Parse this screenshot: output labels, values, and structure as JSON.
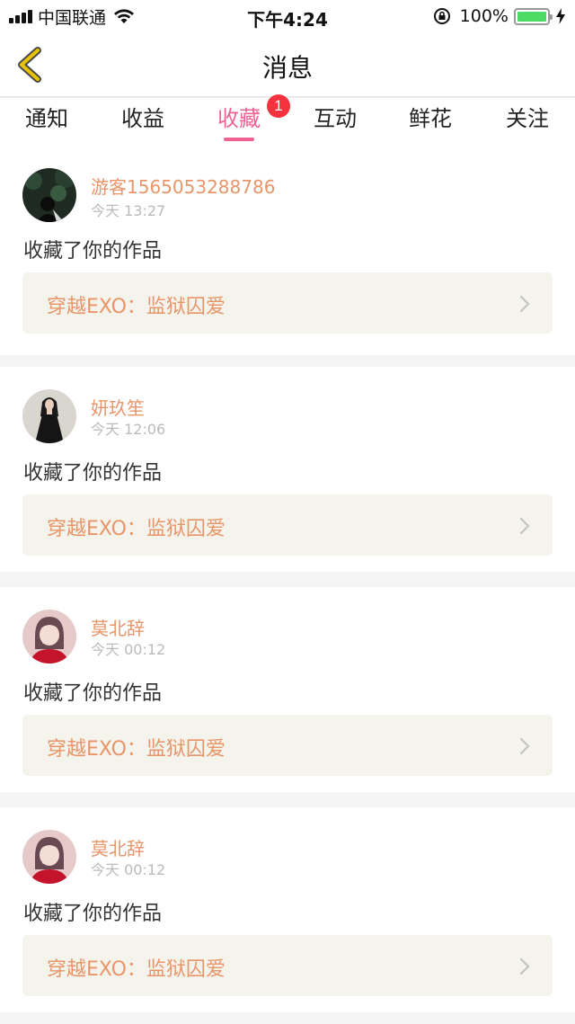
{
  "status_bar": {
    "carrier": "中国联通",
    "time": "下午4:24",
    "battery": "100%",
    "battery_level": 1.0,
    "signal_icon": "signal-bars-icon",
    "wifi_icon": "wifi-icon",
    "lock_icon": "orientation-lock-icon",
    "charging_icon": "charging-bolt-icon"
  },
  "header": {
    "title": "消息",
    "back_icon": "chevron-left-icon",
    "back_color": "#e6c200"
  },
  "tabs": [
    {
      "label": "通知",
      "active": false
    },
    {
      "label": "收益",
      "active": false
    },
    {
      "label": "收藏",
      "active": true,
      "badge": "1"
    },
    {
      "label": "互动",
      "active": false
    },
    {
      "label": "鲜花",
      "active": false
    },
    {
      "label": "关注",
      "active": false
    }
  ],
  "colors": {
    "accent_pink": "#f06292",
    "badge_red": "#f5333f",
    "name_orange": "#e8956a",
    "work_box_bg": "#f4f4ec"
  },
  "messages": [
    {
      "user": "游客1565053288786",
      "time": "今天 13:27",
      "action": "收藏了你的作品",
      "work": "穿越EXO：监狱囚爱",
      "avatar_icon": "avatar-dark-forest-icon"
    },
    {
      "user": "妍玖笙",
      "time": "今天 12:06",
      "action": "收藏了你的作品",
      "work": "穿越EXO：监狱囚爱",
      "avatar_icon": "avatar-girl-black-dress-icon"
    },
    {
      "user": "莫北辞",
      "time": "今天 00:12",
      "action": "收藏了你的作品",
      "work": "穿越EXO：监狱囚爱",
      "avatar_icon": "avatar-girl-red-icon"
    },
    {
      "user": "莫北辞",
      "time": "今天 00:12",
      "action": "收藏了你的作品",
      "work": "穿越EXO：监狱囚爱",
      "avatar_icon": "avatar-girl-red-icon"
    }
  ]
}
